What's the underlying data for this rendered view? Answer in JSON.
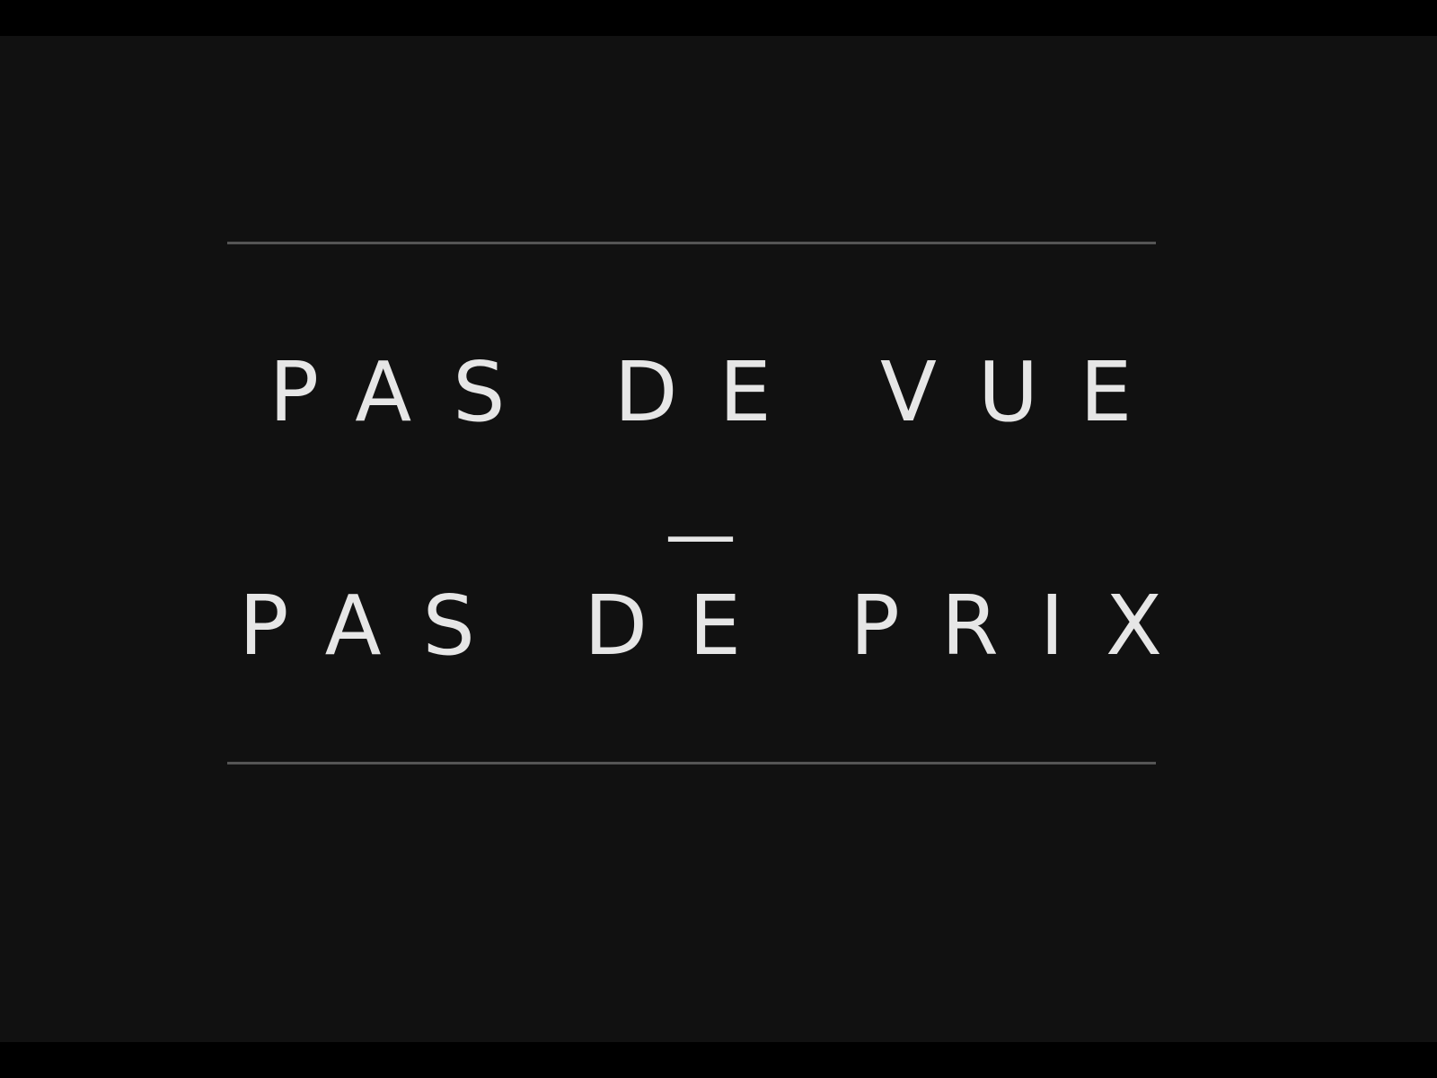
{
  "slide": {
    "line1": "PAS DE VUE",
    "separator": "—",
    "line2": "PAS DE PRIX"
  },
  "colors": {
    "background": "#111111",
    "letterbox": "#000000",
    "text": "#e6e6e6",
    "rule": "#555555"
  }
}
